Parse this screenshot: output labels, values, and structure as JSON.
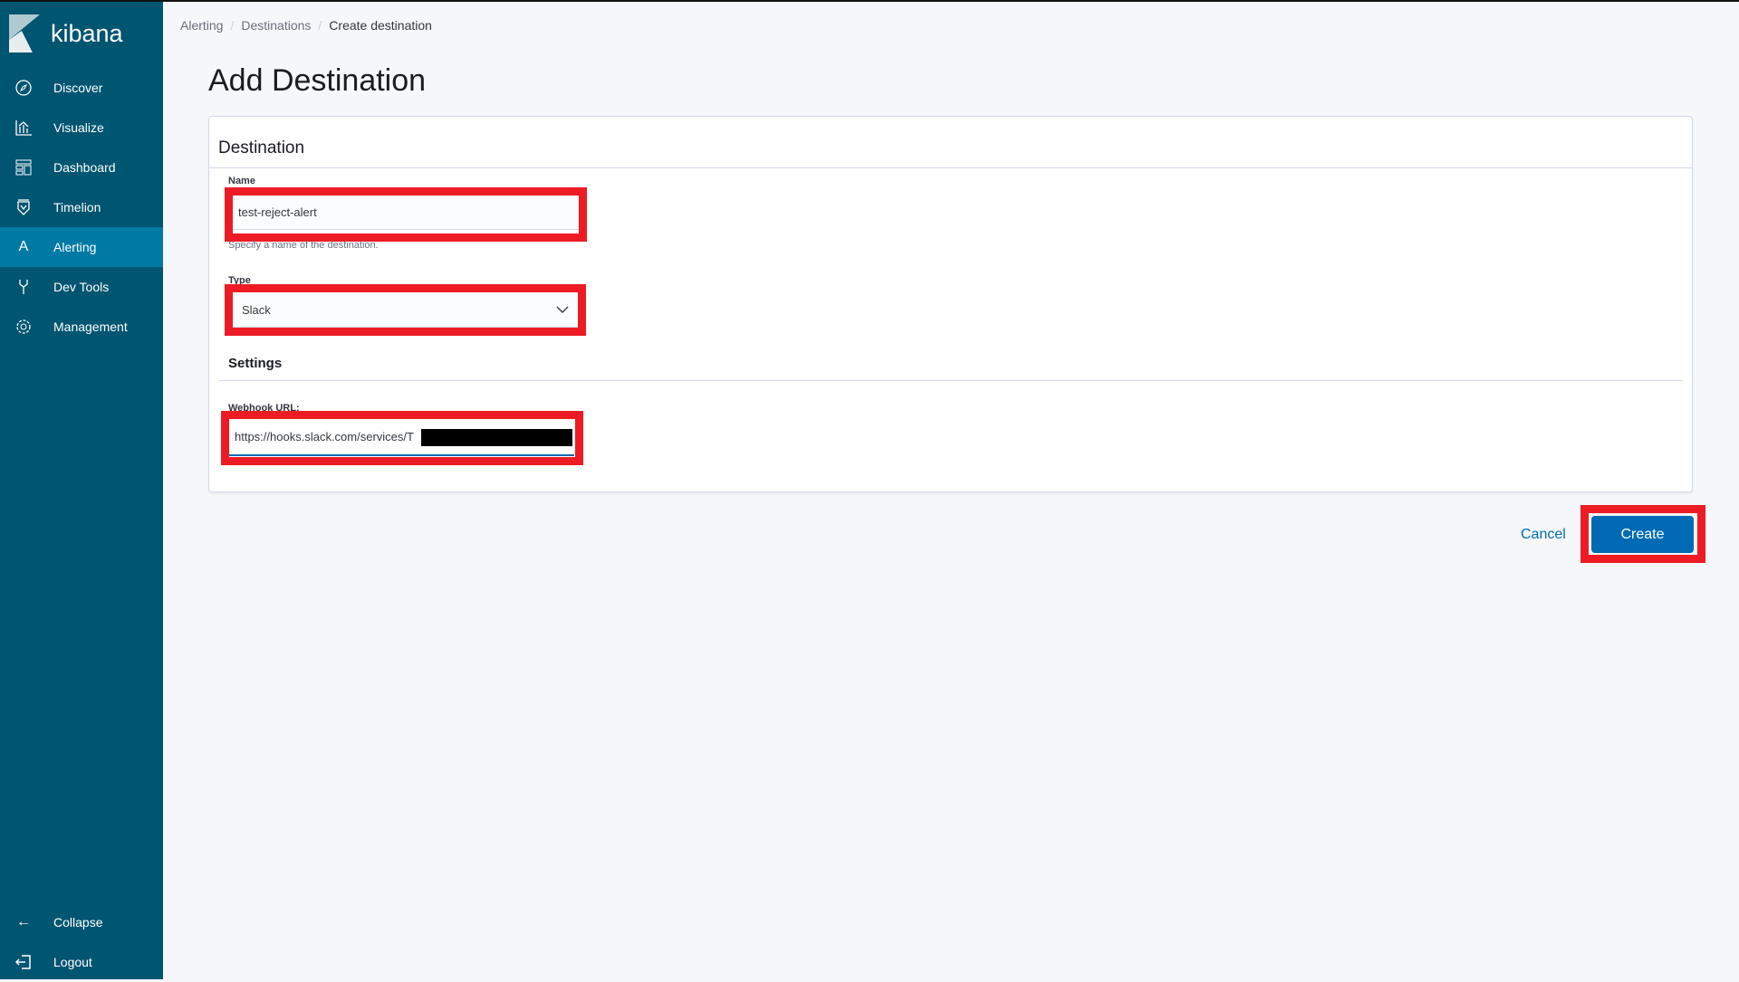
{
  "app": {
    "name": "kibana"
  },
  "sidebar": {
    "items": [
      {
        "label": "Discover",
        "icon": "compass-icon"
      },
      {
        "label": "Visualize",
        "icon": "chart-icon"
      },
      {
        "label": "Dashboard",
        "icon": "dashboard-icon"
      },
      {
        "label": "Timelion",
        "icon": "timelion-icon"
      },
      {
        "label": "Alerting",
        "icon": "A"
      },
      {
        "label": "Dev Tools",
        "icon": "wrench-icon"
      },
      {
        "label": "Management",
        "icon": "gear-icon"
      }
    ],
    "active": "Alerting",
    "collapse": "Collapse",
    "logout": "Logout"
  },
  "breadcrumb": [
    "Alerting",
    "Destinations",
    "Create destination"
  ],
  "page": {
    "title": "Add Destination"
  },
  "form": {
    "panel_title": "Destination",
    "name_label": "Name",
    "name_value": "test-reject-alert",
    "name_help": "Specify a name of the destination.",
    "type_label": "Type",
    "type_value": "Slack",
    "settings_title": "Settings",
    "webhook_label": "Webhook URL:",
    "webhook_value": "https://hooks.slack.com/services/T"
  },
  "actions": {
    "cancel": "Cancel",
    "create": "Create"
  },
  "colors": {
    "sidebar": "#005571",
    "active": "#0079a5",
    "primary": "#006bb4",
    "highlight": "#ed1c24"
  }
}
